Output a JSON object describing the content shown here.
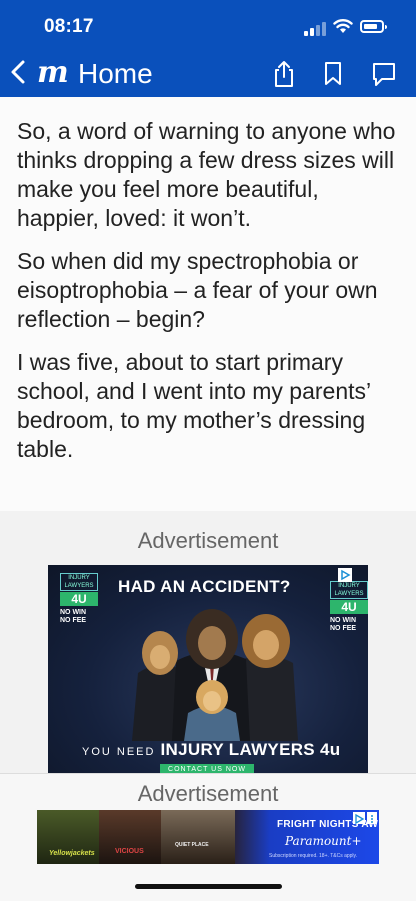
{
  "status_bar": {
    "time": "08:17"
  },
  "nav": {
    "logo": "m",
    "back_label": "Home"
  },
  "article": {
    "paragraphs": [
      "So, a word of warning to anyone who thinks dropping a few dress sizes will make you feel more beautiful, happier, loved: it won’t.",
      "So when did my spectrophobia or eisoptrophobia – a fear of your own reflection – begin?",
      "I was five, about to start primary school, and I went into my parents’ bedroom, to my mother’s dressing table."
    ]
  },
  "ad1": {
    "label": "Advertisement",
    "brand_top": "INJURY LAWYERS",
    "brand_num": "4U",
    "no_win": "NO WIN",
    "no_fee": "NO FEE",
    "headline": "HAD AN ACCIDENT?",
    "tagline_small": "YOU NEED",
    "tagline_big": "INJURY LAWYERS 4u",
    "cta": "CONTACT US NOW"
  },
  "ad2": {
    "label": "Advertisement",
    "show1": "Yellowjackets",
    "show2": "VICIOUS",
    "show3": "QUIET PLACE",
    "headline": "FRIGHT NIGHTS AW",
    "brand": "Paramount+",
    "fine_print": "Subscription required. 18+. T&Cs apply."
  },
  "colors": {
    "header": "#0a50bb",
    "ad_green": "#2db56c"
  },
  "icons": [
    "back-chevron-icon",
    "share-icon",
    "bookmark-icon",
    "comment-icon",
    "wifi-icon",
    "battery-icon",
    "signal-icon",
    "adchoices-icon",
    "close-icon"
  ]
}
